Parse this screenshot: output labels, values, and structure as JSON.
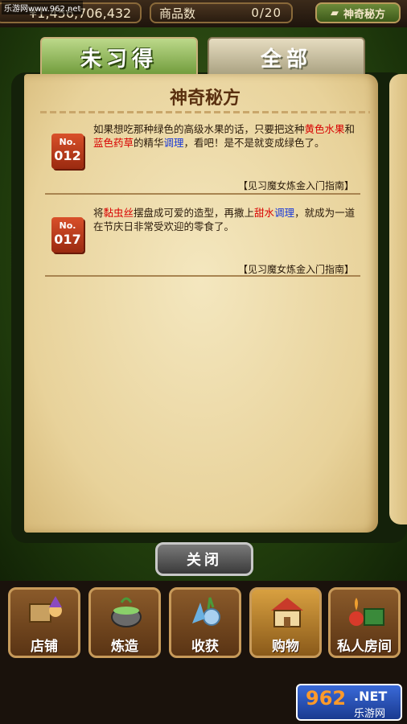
{
  "topbar": {
    "money": "¥1,456,706,432",
    "goods_label": "商品数",
    "goods_count": "0/20",
    "recipe_button": "神奇秘方",
    "watermark": "乐游网www.962.net"
  },
  "tabs": [
    {
      "label": "未习得",
      "active": true
    },
    {
      "label": "全部",
      "active": false
    }
  ],
  "book": {
    "title": "神奇秘方",
    "entries": [
      {
        "no": "No.",
        "num": "012",
        "segments": [
          {
            "t": "如果想吃那种绿色的高级水果的话，只要把这种"
          },
          {
            "t": "黄色水果",
            "c": "red"
          },
          {
            "t": "和"
          },
          {
            "t": "蓝色药草",
            "c": "red"
          },
          {
            "t": "的精华"
          },
          {
            "t": "调理",
            "c": "blue"
          },
          {
            "t": "，看吧！是不是就变成绿色了。"
          }
        ],
        "source": "【见习魔女炼金入门指南】"
      },
      {
        "no": "No.",
        "num": "017",
        "segments": [
          {
            "t": "将"
          },
          {
            "t": "黏虫丝",
            "c": "red"
          },
          {
            "t": "摆盘成可爱的造型，再撒上"
          },
          {
            "t": "甜水",
            "c": "red"
          },
          {
            "t": "调理",
            "c": "blue"
          },
          {
            "t": "，就成为一道在节庆日非常受欢迎的零食了。"
          }
        ],
        "source": "【见习魔女炼金入门指南】"
      }
    ]
  },
  "close_button": "关闭",
  "nav": [
    {
      "label": "店铺",
      "icon": "shop-icon",
      "active": false
    },
    {
      "label": "炼造",
      "icon": "cauldron-icon",
      "active": false
    },
    {
      "label": "收获",
      "icon": "harvest-icon",
      "active": false
    },
    {
      "label": "购物",
      "icon": "house-icon",
      "active": true
    },
    {
      "label": "私人房间",
      "icon": "room-icon",
      "active": false
    }
  ],
  "watermark_logo": {
    "num": "962",
    "net": ".NET",
    "cn": "乐游网"
  }
}
